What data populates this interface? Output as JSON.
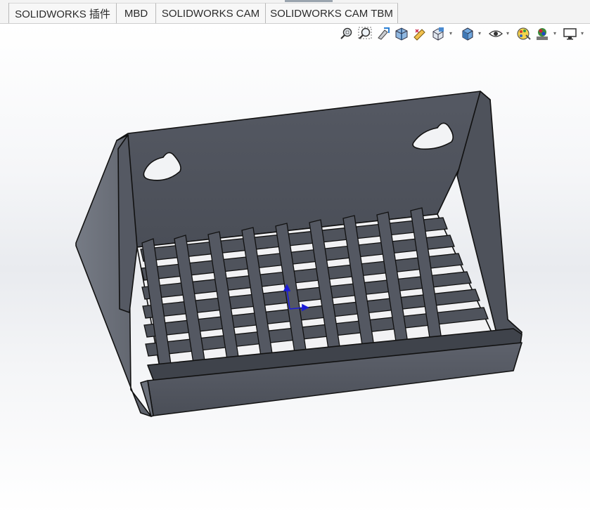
{
  "tabs": [
    {
      "label": "SOLIDWORKS 插件",
      "active": false
    },
    {
      "label": "MBD",
      "active": false
    },
    {
      "label": "SOLIDWORKS CAM",
      "active": false
    },
    {
      "label": "SOLIDWORKS CAM TBM",
      "active": false
    }
  ],
  "heads_up_toolbar": {
    "icons": [
      "zoom-to-fit-icon",
      "zoom-to-area-icon",
      "previous-view-icon",
      "section-view-icon",
      "dynamic-annotation-view-icon",
      "view-orientation-icon",
      "display-style-icon",
      "hide-show-items-icon",
      "edit-appearance-icon",
      "apply-scene-icon",
      "view-settings-icon"
    ]
  },
  "colors": {
    "model_face_dark": "#4e525c",
    "model_face_mid": "#5d616b",
    "model_face_light": "#6e737d",
    "model_edge": "#111111",
    "triad_blue": "#1b1bd6"
  }
}
